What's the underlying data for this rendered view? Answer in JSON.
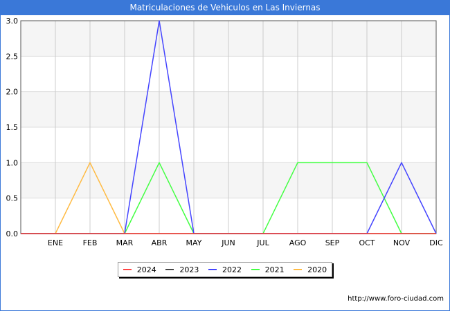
{
  "header": {
    "title": "Matriculaciones de Vehiculos en Las Inviernas"
  },
  "footer": {
    "source": "http://www.foro-ciudad.com"
  },
  "chart_data": {
    "type": "line",
    "title": "Matriculaciones de Vehiculos en Las Inviernas",
    "xlabel": "",
    "ylabel": "",
    "categories": [
      "",
      "ENE",
      "FEB",
      "MAR",
      "ABR",
      "MAY",
      "JUN",
      "JUL",
      "AGO",
      "SEP",
      "OCT",
      "NOV",
      "DIC"
    ],
    "ylim": [
      0,
      3.0
    ],
    "yticks": [
      "0.0",
      "0.5",
      "1.0",
      "1.5",
      "2.0",
      "2.5",
      "3.0"
    ],
    "grid": true,
    "legend_position": "bottom",
    "series": [
      {
        "name": "2024",
        "color": "#ff4444",
        "values": [
          0,
          0,
          0,
          0,
          0,
          0,
          0,
          0,
          0,
          0,
          0,
          0,
          0
        ]
      },
      {
        "name": "2023",
        "color": "#444444",
        "values": [
          0,
          0,
          0,
          0,
          0,
          0,
          0,
          0,
          0,
          0,
          0,
          0,
          0
        ]
      },
      {
        "name": "2022",
        "color": "#4444ff",
        "values": [
          0,
          0,
          0,
          0,
          3,
          0,
          0,
          0,
          0,
          0,
          0,
          1,
          0
        ]
      },
      {
        "name": "2021",
        "color": "#44ff44",
        "values": [
          0,
          0,
          0,
          0,
          1,
          0,
          0,
          0,
          1,
          1,
          1,
          0,
          0
        ]
      },
      {
        "name": "2020",
        "color": "#ffbb44",
        "values": [
          0,
          0,
          1,
          0,
          0,
          0,
          0,
          0,
          0,
          0,
          0,
          0,
          0
        ]
      }
    ]
  }
}
